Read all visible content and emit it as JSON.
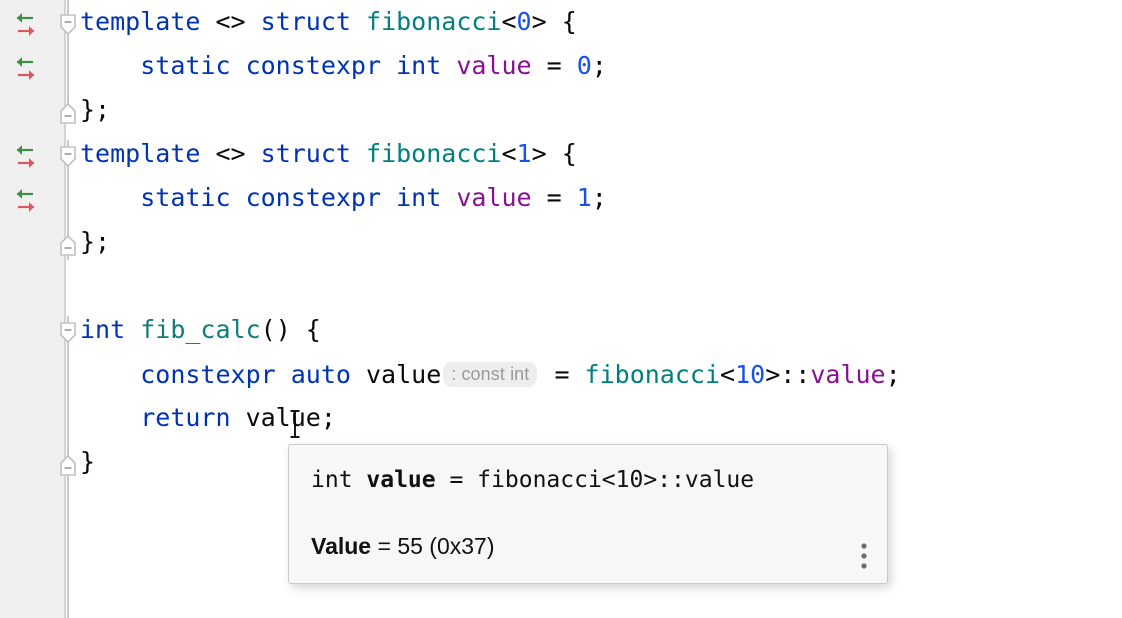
{
  "editor": {
    "language": "cpp",
    "background_color": "#ffffff",
    "gutter_color": "#f0f0f0",
    "colors": {
      "keyword": "#0033b3",
      "class_name": "#00807f",
      "function_name": "#0d7e7a",
      "number": "#1750eb",
      "field": "#871094",
      "plain": "#080808",
      "inlay_hint_text": "#9a9a9a",
      "inlay_hint_background": "#eeeeee",
      "gutter_icon_incoming": "#3f9142",
      "gutter_icon_outgoing": "#db5860",
      "fold_marker": "#c0c0c0"
    },
    "lines": [
      {
        "number": 1,
        "tokens": [
          {
            "text": "template",
            "style": "kw"
          },
          {
            "text": " <> ",
            "style": "pln"
          },
          {
            "text": "struct",
            "style": "kw"
          },
          {
            "text": " ",
            "style": "pln"
          },
          {
            "text": "fibonacci",
            "style": "cls"
          },
          {
            "text": "<",
            "style": "pln"
          },
          {
            "text": "0",
            "style": "num"
          },
          {
            "text": "> {",
            "style": "pln"
          }
        ]
      },
      {
        "number": 2,
        "tokens": [
          {
            "text": "    ",
            "style": "pln"
          },
          {
            "text": "static constexpr int",
            "style": "kw"
          },
          {
            "text": " ",
            "style": "pln"
          },
          {
            "text": "value",
            "style": "fld"
          },
          {
            "text": " = ",
            "style": "pln"
          },
          {
            "text": "0",
            "style": "num"
          },
          {
            "text": ";",
            "style": "pln"
          }
        ]
      },
      {
        "number": 3,
        "tokens": [
          {
            "text": "};",
            "style": "pln"
          }
        ]
      },
      {
        "number": 4,
        "tokens": [
          {
            "text": "template",
            "style": "kw"
          },
          {
            "text": " <> ",
            "style": "pln"
          },
          {
            "text": "struct",
            "style": "kw"
          },
          {
            "text": " ",
            "style": "pln"
          },
          {
            "text": "fibonacci",
            "style": "cls"
          },
          {
            "text": "<",
            "style": "pln"
          },
          {
            "text": "1",
            "style": "num"
          },
          {
            "text": "> {",
            "style": "pln"
          }
        ]
      },
      {
        "number": 5,
        "tokens": [
          {
            "text": "    ",
            "style": "pln"
          },
          {
            "text": "static constexpr int",
            "style": "kw"
          },
          {
            "text": " ",
            "style": "pln"
          },
          {
            "text": "value",
            "style": "fld"
          },
          {
            "text": " = ",
            "style": "pln"
          },
          {
            "text": "1",
            "style": "num"
          },
          {
            "text": ";",
            "style": "pln"
          }
        ]
      },
      {
        "number": 6,
        "tokens": [
          {
            "text": "};",
            "style": "pln"
          }
        ]
      },
      {
        "number": 7,
        "tokens": []
      },
      {
        "number": 8,
        "tokens": [
          {
            "text": "int",
            "style": "kw"
          },
          {
            "text": " ",
            "style": "pln"
          },
          {
            "text": "fib_calc",
            "style": "type"
          },
          {
            "text": "() {",
            "style": "pln"
          }
        ]
      },
      {
        "number": 9,
        "tokens": [
          {
            "text": "    ",
            "style": "pln"
          },
          {
            "text": "constexpr auto",
            "style": "kw"
          },
          {
            "text": " value",
            "style": "pln"
          },
          {
            "text": ": const int",
            "style": "inlay"
          },
          {
            "text": " = ",
            "style": "pln"
          },
          {
            "text": "fibonacci",
            "style": "cls"
          },
          {
            "text": "<",
            "style": "pln"
          },
          {
            "text": "10",
            "style": "num"
          },
          {
            "text": ">::",
            "style": "pln"
          },
          {
            "text": "value",
            "style": "fld"
          },
          {
            "text": ";",
            "style": "pln"
          }
        ]
      },
      {
        "number": 10,
        "tokens": [
          {
            "text": "    ",
            "style": "pln"
          },
          {
            "text": "return",
            "style": "kw"
          },
          {
            "text": " value;",
            "style": "pln"
          }
        ]
      },
      {
        "number": 11,
        "tokens": [
          {
            "text": "}",
            "style": "pln"
          }
        ]
      }
    ],
    "gutter_icons": [
      {
        "line": 1,
        "name": "implemented-method-marker"
      },
      {
        "line": 2,
        "name": "implemented-method-marker"
      },
      {
        "line": 4,
        "name": "implemented-method-marker"
      },
      {
        "line": 5,
        "name": "implemented-method-marker"
      }
    ],
    "fold_markers": [
      {
        "line": 1,
        "direction": "collapse-down",
        "state": "expanded"
      },
      {
        "line": 3,
        "direction": "collapse-up",
        "state": "expanded"
      },
      {
        "line": 4,
        "direction": "collapse-down",
        "state": "expanded"
      },
      {
        "line": 6,
        "direction": "collapse-up",
        "state": "expanded"
      },
      {
        "line": 8,
        "direction": "collapse-down",
        "state": "expanded"
      },
      {
        "line": 11,
        "direction": "collapse-up",
        "state": "expanded"
      }
    ]
  },
  "tooltip": {
    "signature_prefix": "int ",
    "signature_name": "value",
    "signature_suffix": " = fibonacci<10>::value",
    "value_label": "Value",
    "value_text": " = 55 (0x37)",
    "value_decimal": "55",
    "value_hex": "0x37",
    "menu_icon": "more-vertical-icon"
  }
}
